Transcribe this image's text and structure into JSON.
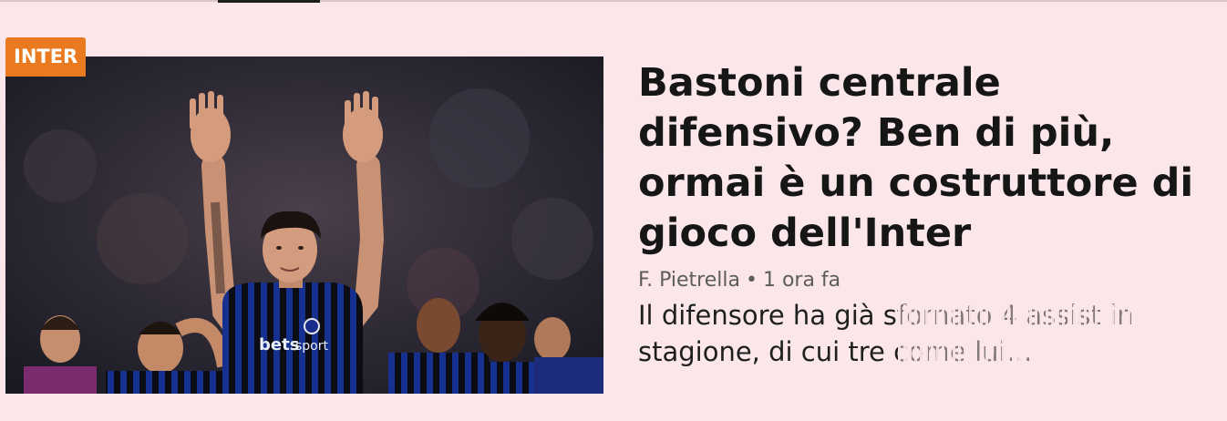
{
  "category": {
    "label": "INTER",
    "color": "#ea7a1f"
  },
  "headline": "Bastoni centrale difensivo? Ben di più, ormai è un costruttore di gioco dell'Inter",
  "meta": {
    "author": "F. Pietrella",
    "separator": "•",
    "time": "1 ora fa"
  },
  "excerpt": "Il difensore ha già sfornato 4 assist in stagione, di cui tre come lui…",
  "colors": {
    "background": "#fbe7ea",
    "headline": "#161616",
    "meta": "#5c5c5c"
  }
}
